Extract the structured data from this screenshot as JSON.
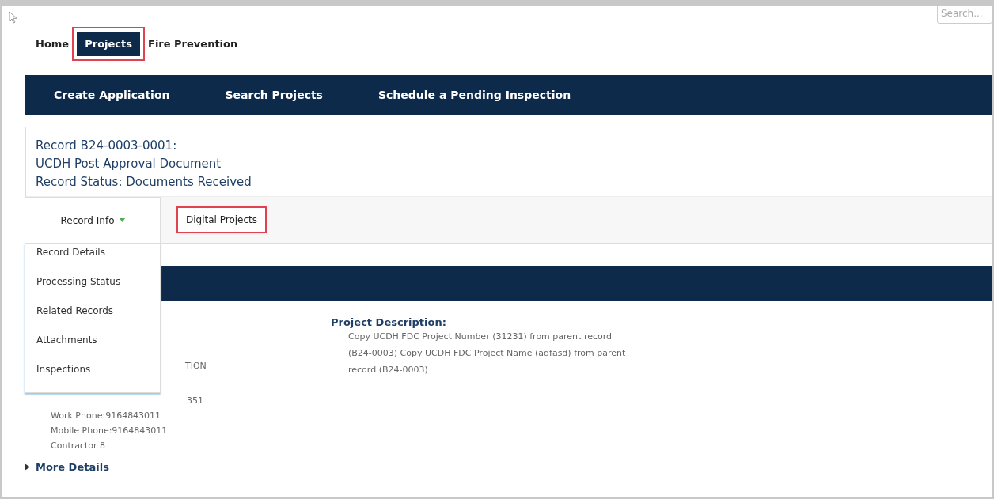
{
  "search": {
    "placeholder": "Search..."
  },
  "top_nav": [
    {
      "label": "Home",
      "selected": false,
      "highlighted": false
    },
    {
      "label": "Projects",
      "selected": true,
      "highlighted": true
    },
    {
      "label": "Fire Prevention",
      "selected": false,
      "highlighted": false
    }
  ],
  "sub_nav": [
    "Create Application",
    "Search Projects",
    "Schedule a Pending Inspection"
  ],
  "record": {
    "title_lines": [
      "Record B24-0003-0001:",
      "UCDH Post Approval Document",
      "Record Status: Documents Received"
    ]
  },
  "record_tabs": [
    {
      "label": "Record Info",
      "expanded": true,
      "highlighted": false
    },
    {
      "label": "Digital Projects",
      "expanded": false,
      "highlighted": true
    }
  ],
  "record_info_menu": [
    "Record Details",
    "Processing Status",
    "Related Records",
    "Attachments",
    "Inspections"
  ],
  "details": {
    "left_column": [
      "TION",
      "351",
      "Work Phone:9164843011",
      "Mobile Phone:9164843011",
      "Contractor 8"
    ],
    "project_description": {
      "label": "Project Description:",
      "text": "Copy UCDH FDC Project Number (31231) from parent record (B24-0003) Copy UCDH FDC Project Name (adfasd) from parent record (B24-0003)"
    }
  },
  "more_details": {
    "label": "More Details",
    "expanded": false
  }
}
